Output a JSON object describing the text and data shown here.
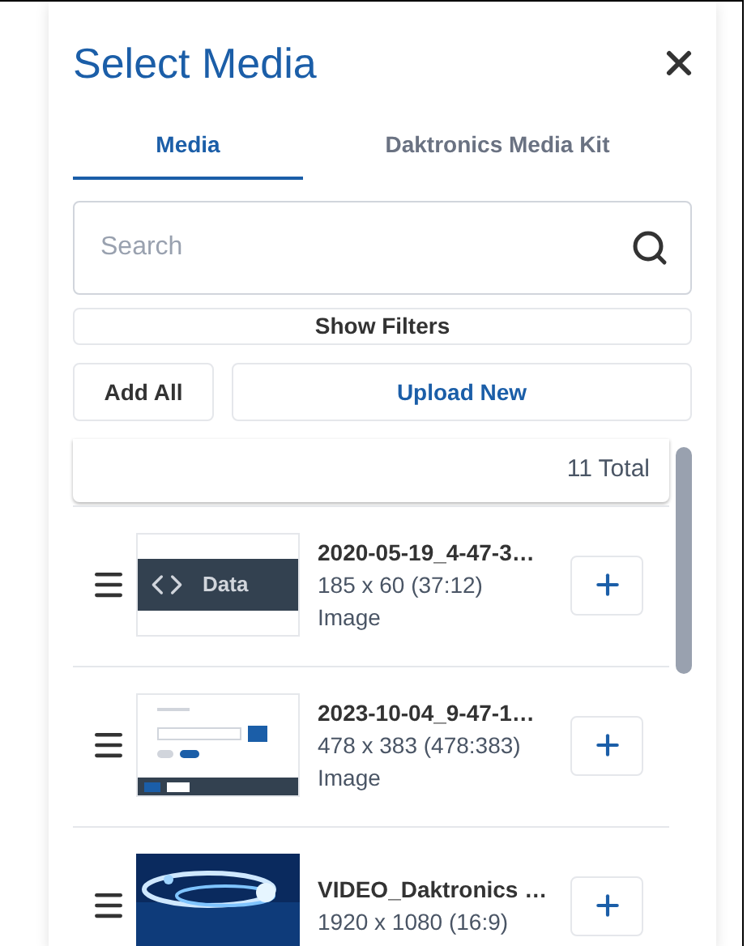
{
  "dialog": {
    "title": "Select Media"
  },
  "tabs": [
    {
      "label": "Media",
      "selected": true
    },
    {
      "label": "Daktronics Media Kit",
      "selected": false
    }
  ],
  "search": {
    "placeholder": "Search"
  },
  "filters_button": "Show Filters",
  "actions": {
    "add_all": "Add All",
    "upload": "Upload New"
  },
  "total": "11 Total",
  "items": [
    {
      "name": "2020-05-19_4-47-3…",
      "size": "185 x 60 (37:12)",
      "type": "Image",
      "thumbnail": {
        "kind": "banner",
        "label": "Data"
      }
    },
    {
      "name": "2023-10-04_9-47-1…",
      "size": "478 x 383 (478:383)",
      "type": "Image",
      "thumbnail": {
        "kind": "form"
      }
    },
    {
      "name": "VIDEO_Daktronics …",
      "size": "1920 x 1080 (16:9)"
    }
  ]
}
